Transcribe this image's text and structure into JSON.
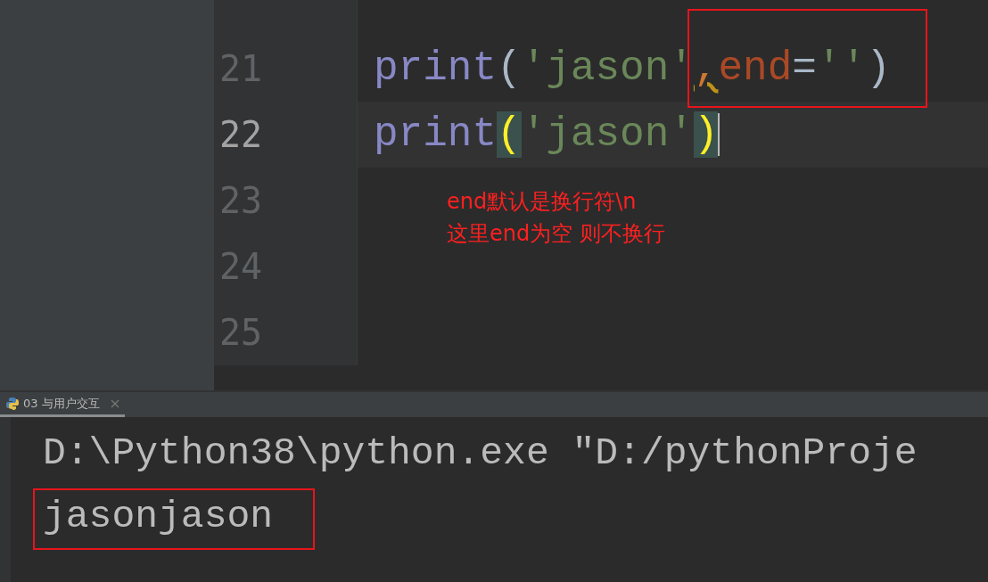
{
  "editor": {
    "lines": [
      {
        "number": "21",
        "current": false,
        "tokens": [
          {
            "kind": "function",
            "text": "print"
          },
          {
            "kind": "paren",
            "text": "(",
            "matched": false
          },
          {
            "kind": "string",
            "text": "'jason'"
          },
          {
            "kind": "warning",
            "text": ","
          },
          {
            "kind": "keyword-arg",
            "text": "end"
          },
          {
            "kind": "operator",
            "text": "="
          },
          {
            "kind": "string",
            "text": "''"
          },
          {
            "kind": "paren",
            "text": ")",
            "matched": false
          }
        ]
      },
      {
        "number": "22",
        "current": true,
        "tokens": [
          {
            "kind": "function",
            "text": "print"
          },
          {
            "kind": "paren",
            "text": "(",
            "matched": true
          },
          {
            "kind": "string",
            "text": "'jason'"
          },
          {
            "kind": "paren",
            "text": ")",
            "matched": true
          }
        ]
      },
      {
        "number": "23",
        "current": false
      },
      {
        "number": "24",
        "current": false
      },
      {
        "number": "25",
        "current": false
      }
    ],
    "note": [
      "end默认是换行符\\n",
      "这里end为空 则不换行"
    ]
  },
  "run_panel": {
    "tab": {
      "label": "03 与用户交互",
      "selected": true
    },
    "output": [
      {
        "text": "D:\\Python38\\python.exe \"D:/pythonProje",
        "highlighted": false
      },
      {
        "text": "jasonjason",
        "highlighted": true
      }
    ]
  }
}
